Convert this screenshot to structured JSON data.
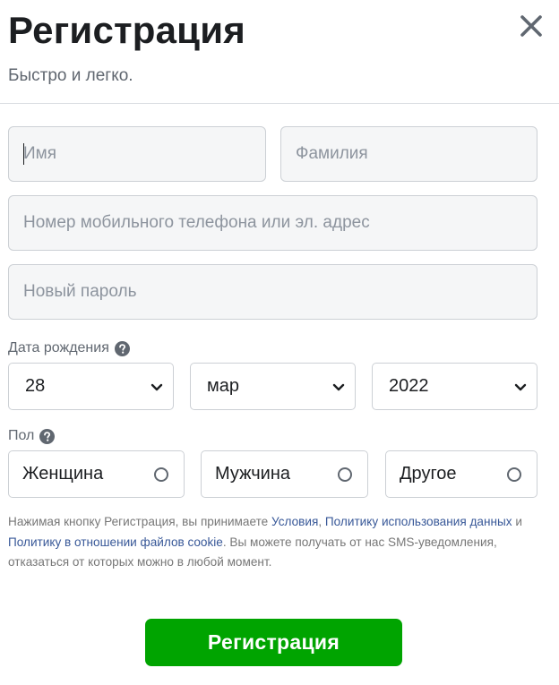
{
  "header": {
    "title": "Регистрация",
    "subtitle": "Быстро и легко.",
    "close_icon": "close-icon"
  },
  "form": {
    "first_name": {
      "placeholder": "Имя",
      "value": ""
    },
    "last_name": {
      "placeholder": "Фамилия",
      "value": ""
    },
    "contact": {
      "placeholder": "Номер мобильного телефона или эл. адрес",
      "value": ""
    },
    "password": {
      "placeholder": "Новый пароль",
      "value": ""
    },
    "birthday": {
      "label": "Дата рождения",
      "help_icon": "question-circle-icon",
      "day": "28",
      "month": "мар",
      "year": "2022"
    },
    "gender": {
      "label": "Пол",
      "help_icon": "question-circle-icon",
      "options": [
        "Женщина",
        "Мужчина",
        "Другое"
      ]
    }
  },
  "terms": {
    "t1": "Нажимая кнопку Регистрация, вы принимаете ",
    "link_terms": "Условия",
    "t2": ", ",
    "link_data_policy": "Политику использования данных",
    "t3": " и ",
    "link_cookie_policy": "Политику в отношении файлов cookie",
    "t4": ". Вы можете получать от нас SMS-уведомления, отказаться от которых можно в любой момент."
  },
  "submit": {
    "label": "Регистрация"
  },
  "colors": {
    "accent_green": "#00a400",
    "link": "#385898",
    "field_bg": "#f5f6f7",
    "border": "#ccd0d5"
  }
}
